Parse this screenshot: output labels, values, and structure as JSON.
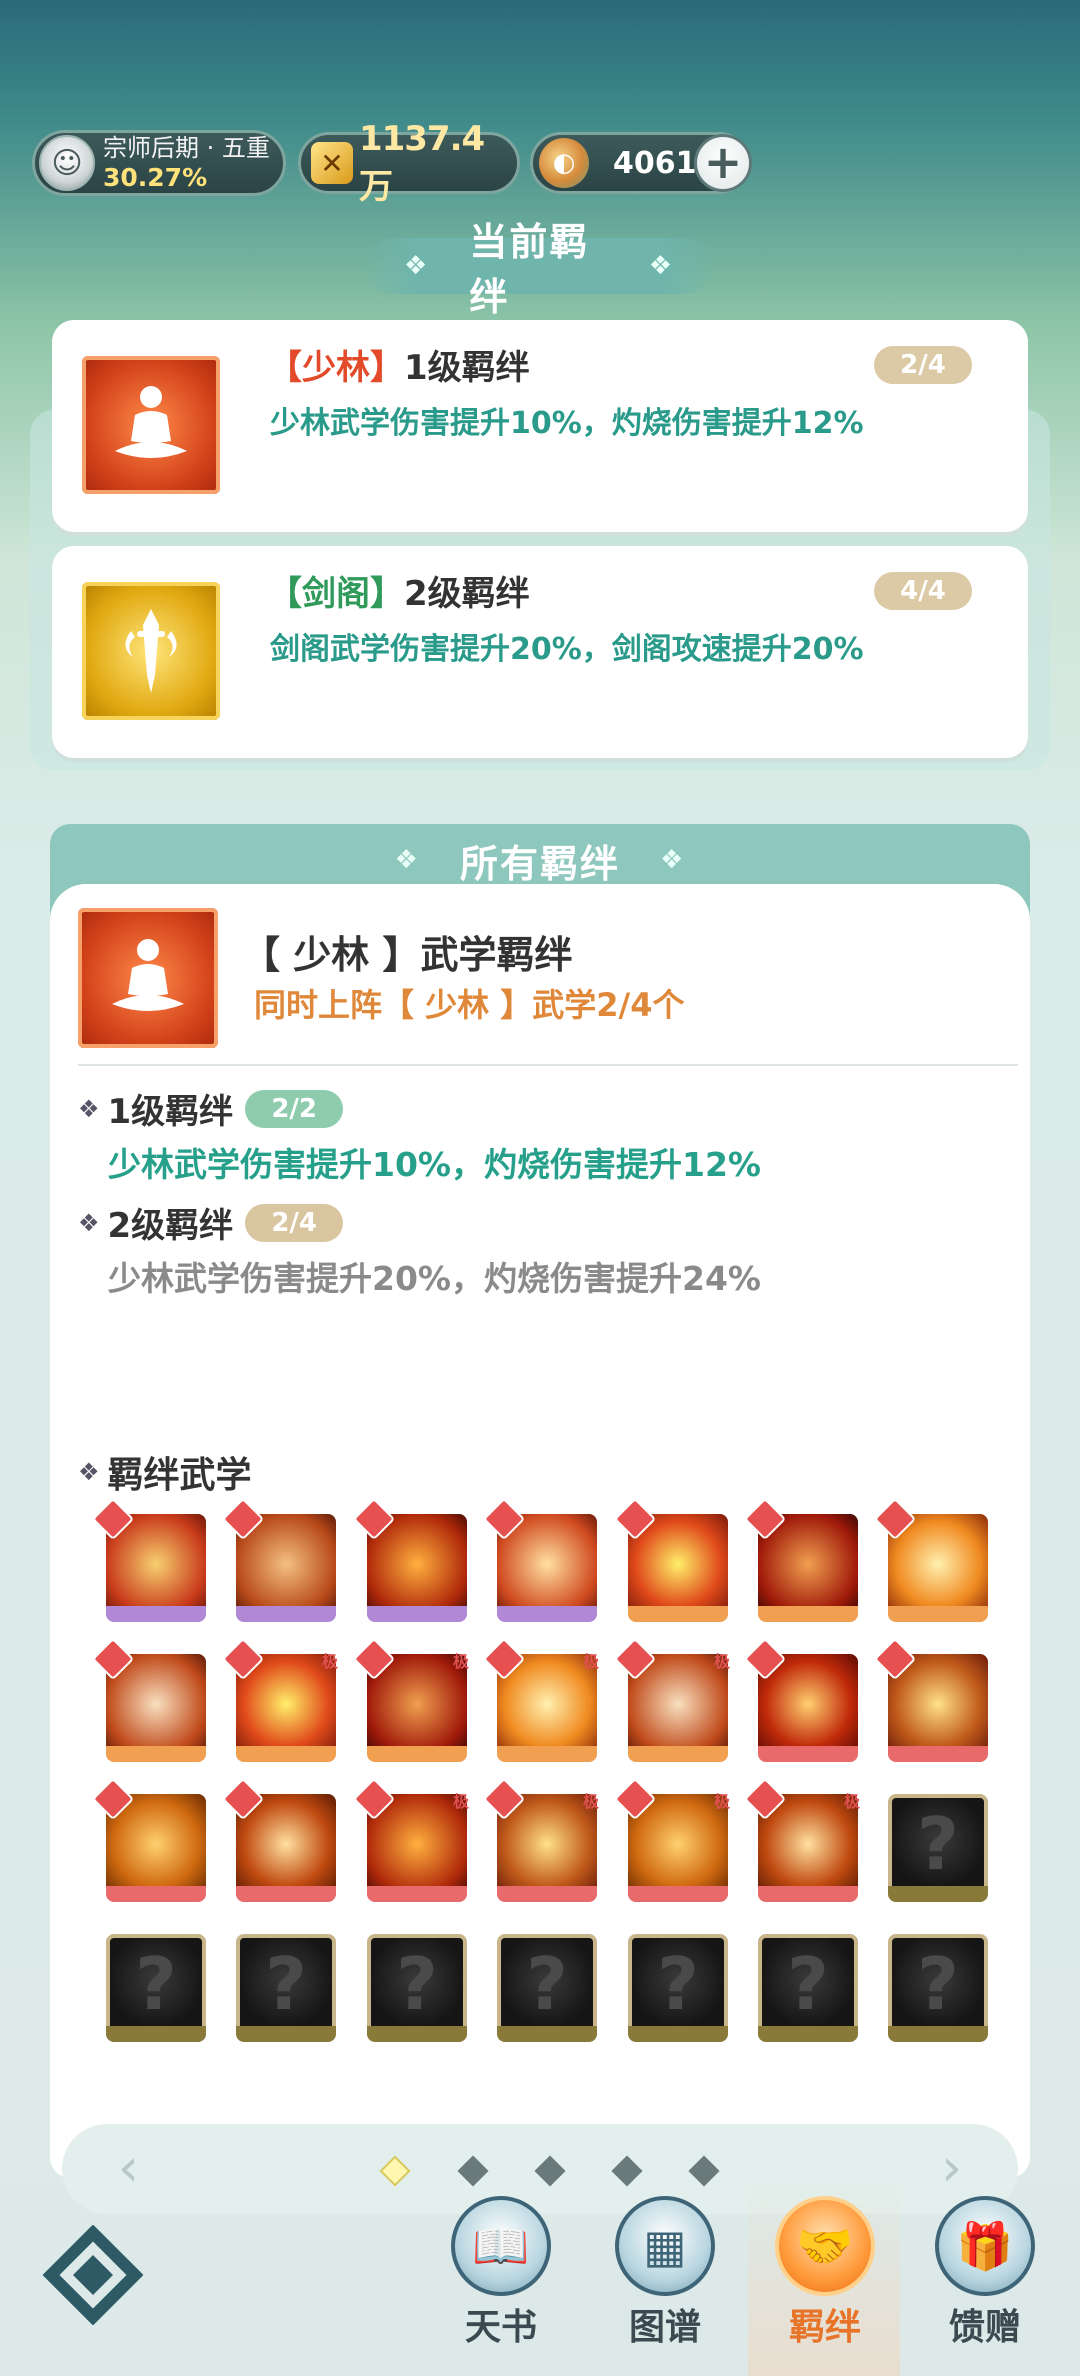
{
  "status_bar": {
    "rank_title": "宗师后期 · 五重",
    "rank_percent": "30.27%",
    "power": "1137.4万",
    "coins": "4061",
    "plus_symbol": "+"
  },
  "current_section": {
    "title": "当前羁绊",
    "bonds": [
      {
        "tag_open": "【",
        "tag": "少林",
        "tag_close": "】",
        "level_text": "1级羁绊",
        "count": "2/4",
        "desc": "少林武学伤害提升10%，灼烧伤害提升12%"
      },
      {
        "tag_open": "【",
        "tag": "剑阁",
        "tag_close": "】",
        "level_text": "2级羁绊",
        "count": "4/4",
        "desc": "剑阁武学伤害提升20%，剑阁攻速提升20%"
      }
    ]
  },
  "all_section": {
    "title": "所有羁绊",
    "detail_title": "【 少林 】武学羁绊",
    "detail_sub": "同时上阵【 少林 】武学2/4个",
    "levels": [
      {
        "label": "1级羁绊",
        "badge": "2/2",
        "desc": "少林武学伤害提升10%，灼烧伤害提升12%"
      },
      {
        "label": "2级羁绊",
        "badge": "2/4",
        "desc": "少林武学伤害提升20%，灼烧伤害提升24%"
      }
    ],
    "skills_title": "羁绊武学",
    "skill_marker": "极",
    "locked_symbol": "?"
  },
  "pager": {
    "left_arrow": "‹",
    "right_arrow": "›",
    "pages": 5,
    "active_page": 1
  },
  "bottom_nav": {
    "items": [
      {
        "label": "天书",
        "icon": "book-icon"
      },
      {
        "label": "图谱",
        "icon": "atlas-icon"
      },
      {
        "label": "羁绊",
        "icon": "handshake-icon",
        "active": true
      },
      {
        "label": "馈赠",
        "icon": "gift-icon"
      }
    ]
  },
  "colors": {
    "accent_teal": "#26a08a",
    "accent_orange": "#e8742a",
    "shaolin_red": "#d3421a",
    "jiange_gold": "#e0a810"
  }
}
